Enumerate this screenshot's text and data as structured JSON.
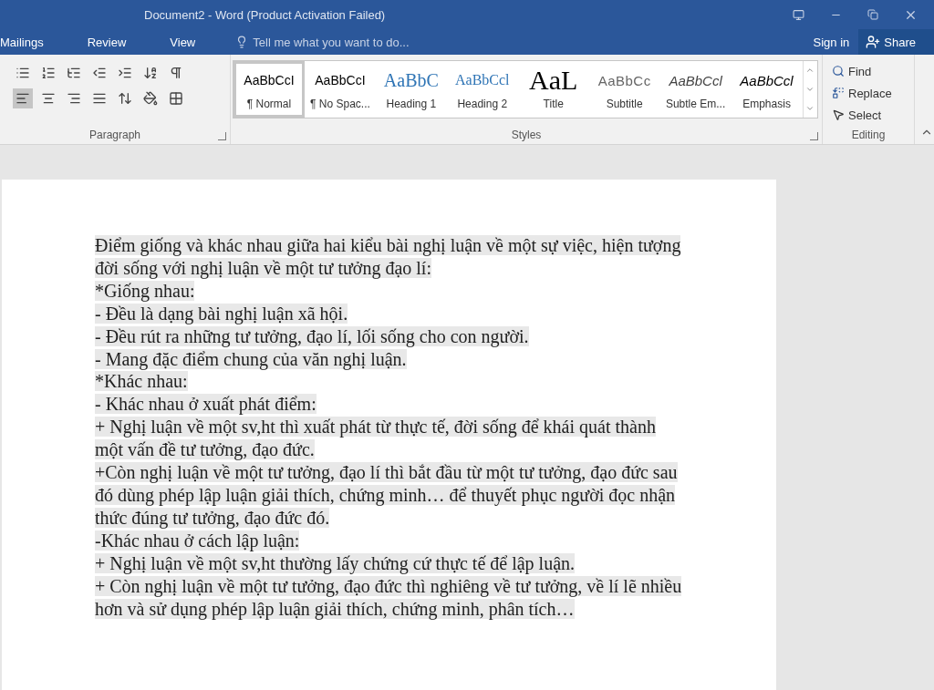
{
  "window": {
    "title": "Document2 - Word (Product Activation Failed)"
  },
  "tabs": [
    {
      "label": "Mailings",
      "selected": false
    },
    {
      "label": "Review",
      "selected": false
    },
    {
      "label": "View",
      "selected": false
    }
  ],
  "tell_me": {
    "placeholder": "Tell me what you want to do..."
  },
  "account": {
    "sign_in": "Sign in",
    "share": "Share"
  },
  "paragraph_group": {
    "label": "Paragraph",
    "alignment": [
      {
        "kind": "left",
        "selected": true
      },
      {
        "kind": "center",
        "selected": false
      },
      {
        "kind": "right",
        "selected": false
      },
      {
        "kind": "justify",
        "selected": false
      }
    ]
  },
  "styles_group": {
    "label": "Styles",
    "items": [
      {
        "kind": "normal",
        "preview": "AaBbCcI",
        "label": "¶ Normal",
        "selected": true
      },
      {
        "kind": "normal",
        "preview": "AaBbCcI",
        "label": "¶ No Spac...",
        "selected": false
      },
      {
        "kind": "heading1",
        "preview": "AaBbC",
        "label": "Heading 1",
        "selected": false
      },
      {
        "kind": "heading2",
        "preview": "AaBbCcl",
        "label": "Heading 2",
        "selected": false
      },
      {
        "kind": "title",
        "preview": "AaL",
        "label": "Title",
        "selected": false
      },
      {
        "kind": "subtitle",
        "preview": "AaBbCc",
        "label": "Subtitle",
        "selected": false
      },
      {
        "kind": "subtle",
        "preview": "AaBbCcl",
        "label": "Subtle Em...",
        "selected": false
      },
      {
        "kind": "emphasis",
        "preview": "AaBbCcl",
        "label": "Emphasis",
        "selected": false
      }
    ]
  },
  "editing_group": {
    "label": "Editing",
    "find": "Find",
    "replace": "Replace",
    "select": "Select"
  },
  "document": {
    "lines": [
      "Điểm giống và khác nhau giữa hai kiểu bài nghị luận về một sự việc, hiện tượng",
      "đời sống với nghị luận về một tư tưởng đạo lí:",
      "*Giống nhau:",
      "- Đều là dạng bài nghị luận xã hội.",
      "- Đều rút ra những tư tưởng, đạo lí, lối sống cho con người.",
      "- Mang đặc điểm chung của văn nghị luận.",
      "*Khác nhau:",
      "- Khác nhau ở xuất phát điểm:",
      "+ Nghị luận về một sv,ht thì xuất phát từ thực tế, đời sống để khái quát thành",
      "một vấn đề tư tưởng, đạo đức.",
      "+Còn nghị luận về một tư tưởng, đạo lí thì bắt đầu từ một tư tưởng, đạo đức sau",
      "đó dùng phép lập luận giải thích, chứng minh… để thuyết phục người đọc nhận",
      "thức đúng tư tưởng, đạo đức đó.",
      "-Khác nhau ở cách lập luận:",
      "+ Nghị luận về một sv,ht thường lấy chứng cứ thực tế để lập luận.",
      "+ Còn nghị luận về một tư tưởng, đạo đức thì nghiêng về tư tưởng, về lí lẽ nhiều",
      "hơn và sử dụng phép lập luận giải thích, chứng minh, phân tích…"
    ]
  }
}
